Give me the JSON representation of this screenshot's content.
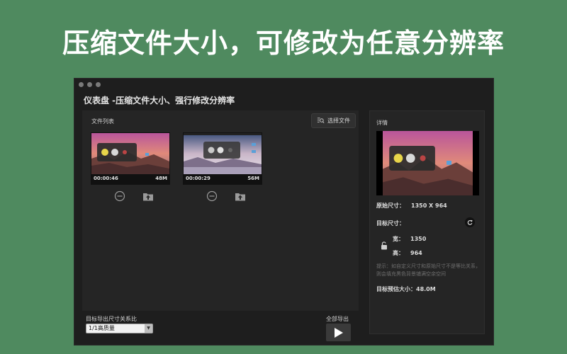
{
  "banner": {
    "text": "压缩文件大小，可修改为任意分辨率"
  },
  "window": {
    "title": "仪表盘 -压缩文件大小、强行修改分辨率"
  },
  "file_list": {
    "label": "文件列表",
    "select_button": "选择文件",
    "files": [
      {
        "duration": "00:00:46",
        "size": "48M"
      },
      {
        "duration": "00:00:29",
        "size": "56M"
      }
    ]
  },
  "details": {
    "title": "详情",
    "original_label": "原始尺寸：",
    "original_value": "1350 X 964",
    "target_label": "目标尺寸：",
    "width_label": "宽：",
    "width_value": "1350",
    "height_label": "高：",
    "height_value": "964",
    "hint": "提示：如自定义尺寸和原始尺寸不是等比关系，则会填充黑色背景铺满空余空间",
    "estimate_label": "目标预估大小：",
    "estimate_value": "48.0M"
  },
  "bottom": {
    "ratio_label": "目标导出尺寸关系比",
    "ratio_value": "1/1高质量",
    "export_all_label": "全部导出"
  },
  "colors": {
    "background": "#4f8a5f",
    "window": "#1e1e1e",
    "panel": "#252525"
  }
}
